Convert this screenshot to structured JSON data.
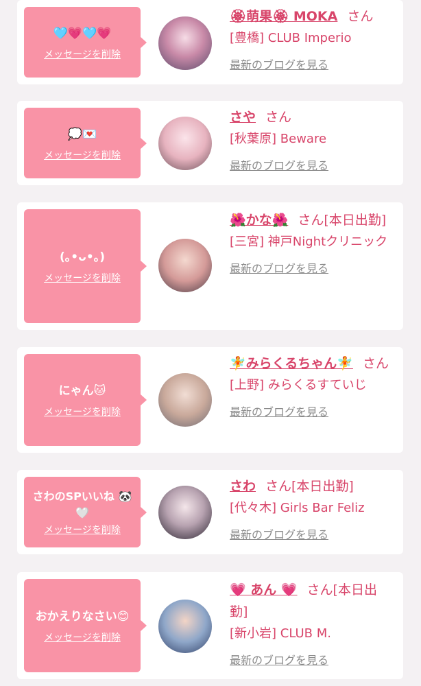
{
  "common": {
    "delete_label": "メッセージを削除",
    "blog_label": "最新のブログを見る"
  },
  "cards": [
    {
      "message": "🩵💗🩵💗",
      "name": "🏵萌果🏵 MOKA",
      "honorific": "さん",
      "shop": "[豊橋] CLUB Imperio"
    },
    {
      "message": "💭💌",
      "name": "さや",
      "honorific": "さん",
      "shop": "[秋葉原] Beware"
    },
    {
      "message": "(｡•ᴗ•｡)",
      "name": "🌺かな🌺",
      "honorific": "さん[本日出勤]",
      "shop": "[三宮] 神戸Nightクリニック"
    },
    {
      "message": "にゃん🐱",
      "name": "🧚みらくるちゃん🧚",
      "honorific": "さん",
      "shop": "[上野] みらくるすていじ"
    },
    {
      "message": "さわのSPいいね 🐼🤍",
      "name": "さわ",
      "honorific": "さん[本日出勤]",
      "shop": "[代々木] Girls Bar Feliz"
    },
    {
      "message": "おかえりなさい😊",
      "name": "💗 あん 💗",
      "honorific": "さん[本日出勤]",
      "shop": "[新小岩] CLUB M."
    }
  ],
  "colors": {
    "bubble": "#f993a6",
    "accent_text": "#d8456a",
    "link_gray": "#8a8a8a",
    "page_bg": "#f4f1f3"
  }
}
